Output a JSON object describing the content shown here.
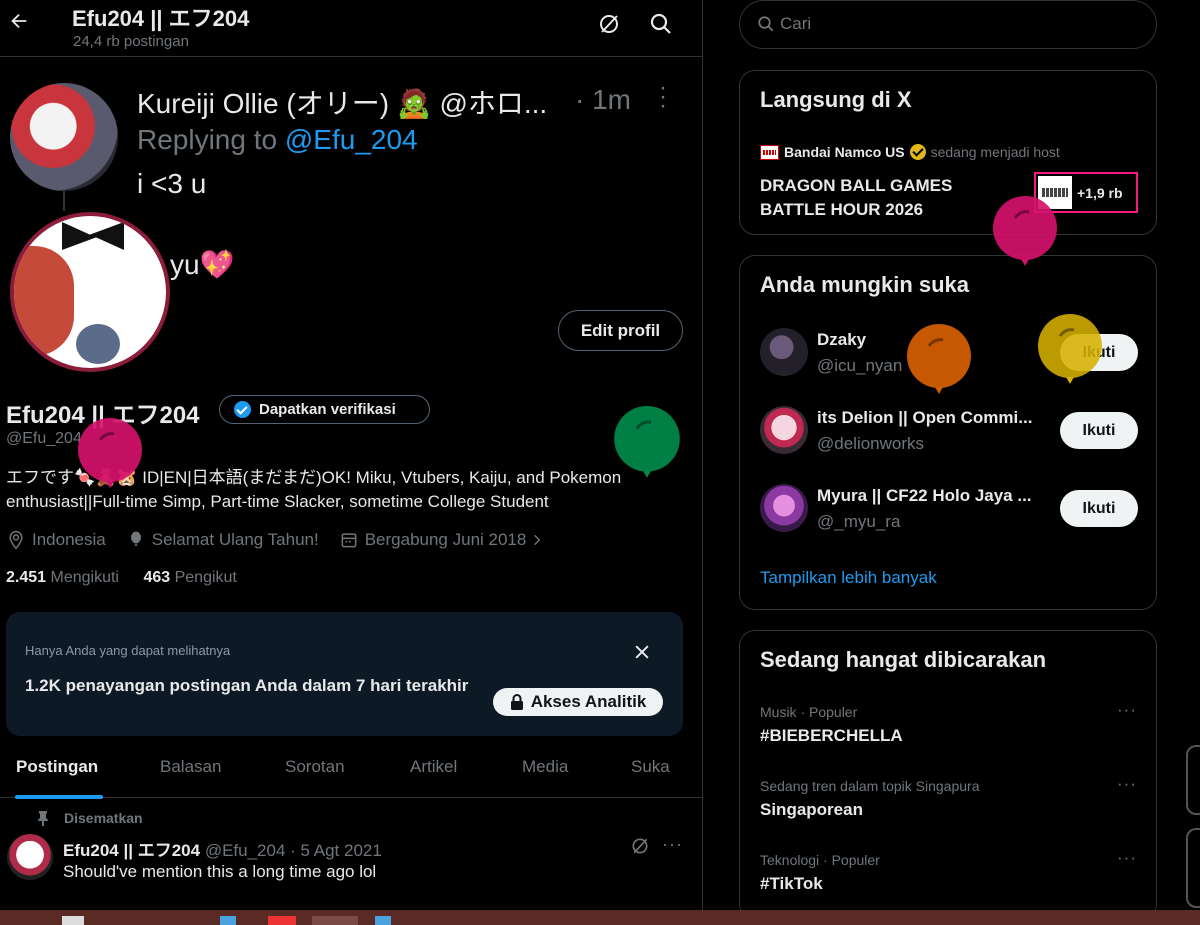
{
  "header": {
    "title": "Efu204 || エフ204",
    "subtitle": "24,4 rb postingan"
  },
  "overlay": {
    "name": "Kureiji Ollie (オリー) 🧟 @ホロ...",
    "time": "· 1m",
    "replying_prefix": "Replying to ",
    "replying_handle": "@Efu_204",
    "text1": "i <3 u",
    "text2": "yu",
    "heart": "💖"
  },
  "profile": {
    "edit_label": "Edit profil",
    "name": "Efu204 || エフ204",
    "verify_label": "Dapatkan verifikasi",
    "handle": "@Efu_204",
    "bio": "エフです🍬🧸🐹 ID|EN|日本語(まだまだ)OK! Miku, Vtubers, Kaiju, and Pokemon enthusiast||Full-time Simp, Part-time Slacker, sometime College Student",
    "location": "Indonesia",
    "birthday": "Selamat Ulang Tahun!",
    "joined": "Bergabung Juni 2018",
    "following_count": "2.451",
    "following_label": "Mengikuti",
    "followers_count": "463",
    "followers_label": "Pengikut"
  },
  "analytics": {
    "note": "Hanya Anda yang dapat melihatnya",
    "main": "1.2K penayangan postingan Anda dalam 7 hari terakhir",
    "button": "Akses Analitik"
  },
  "tabs": [
    "Postingan",
    "Balasan",
    "Sorotan",
    "Artikel",
    "Media",
    "Suka"
  ],
  "pinned_post": {
    "pinned_label": "Disematkan",
    "author": "Efu204 || エフ204",
    "meta": "@Efu_204 · 5 Agt 2021",
    "text": "Should've mention this a long time ago lol",
    "more": "···"
  },
  "search": {
    "placeholder": "Cari"
  },
  "live": {
    "title": "Langsung di X",
    "host_name": "Bandai Namco US",
    "host_suffix": "sedang menjadi host",
    "event_title": "DRAGON BALL GAMES BATTLE HOUR 2026",
    "listener_count": "+1,9 rb"
  },
  "suggestions": {
    "title": "Anda mungkin suka",
    "items": [
      {
        "name": "Dzaky",
        "handle": "@icu_nyan",
        "button": "Ikuti"
      },
      {
        "name": "its Delion || Open Commi...",
        "handle": "@delionworks",
        "button": "Ikuti"
      },
      {
        "name": "Myura || CF22 Holo Jaya ...",
        "handle": "@_myu_ra",
        "button": "Ikuti"
      }
    ],
    "show_more": "Tampilkan lebih banyak"
  },
  "trending": {
    "title": "Sedang hangat dibicarakan",
    "items": [
      {
        "category": "Musik · Populer",
        "name": "#BIEBERCHELLA"
      },
      {
        "category": "Sedang tren dalam topik Singapura",
        "name": "Singaporean"
      },
      {
        "category": "Teknologi · Populer",
        "name": "#TikTok"
      }
    ],
    "more": "···"
  },
  "colors": {
    "accent": "#1d9bf0",
    "background": "#000000",
    "balloon_pink": "#d4116b",
    "balloon_orange": "#d65f00",
    "balloon_yellow": "#d6b100",
    "balloon_green": "#008a4a"
  },
  "icons": [
    "back-arrow-icon",
    "grok-icon",
    "search-icon",
    "more-icon",
    "verified-badge-icon",
    "location-icon",
    "balloon-icon",
    "calendar-icon",
    "chevron-right-icon",
    "close-icon",
    "lock-icon",
    "pin-icon"
  ]
}
